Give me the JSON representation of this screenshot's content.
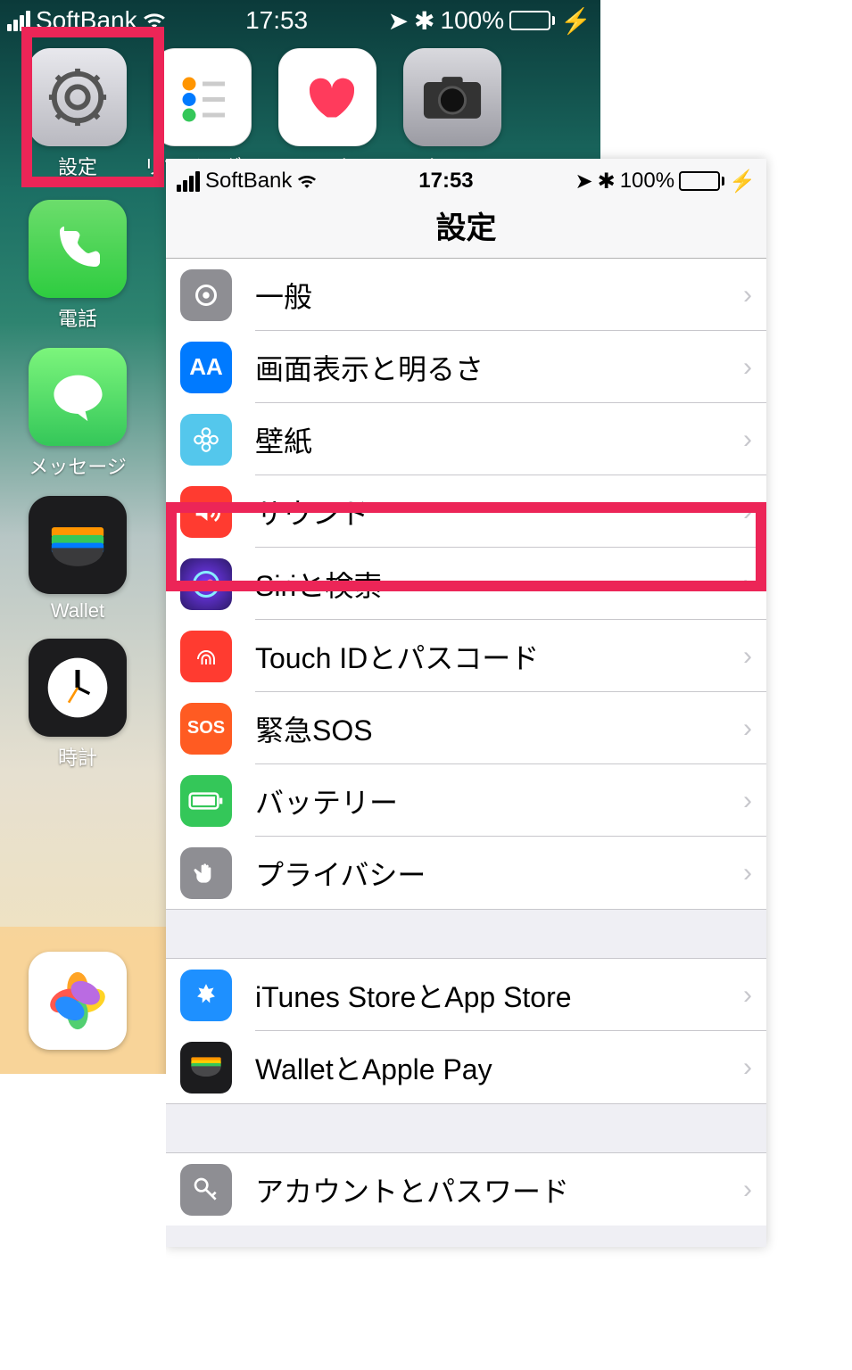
{
  "home": {
    "status": {
      "carrier": "SoftBank",
      "time": "17:53",
      "battery": "100%"
    },
    "apps_row1": [
      {
        "name": "settings",
        "label": "設定"
      },
      {
        "name": "reminders",
        "label": "リマインダー"
      },
      {
        "name": "health",
        "label": "ヘルスケア"
      },
      {
        "name": "camera",
        "label": "カメラ"
      }
    ],
    "apps_col": [
      {
        "name": "phone",
        "label": "電話"
      },
      {
        "name": "messages",
        "label": "メッセージ"
      },
      {
        "name": "wallet",
        "label": "Wallet"
      },
      {
        "name": "clock",
        "label": "時計"
      }
    ],
    "dock_app": {
      "name": "photos",
      "label": ""
    }
  },
  "settings": {
    "status": {
      "carrier": "SoftBank",
      "time": "17:53",
      "battery": "100%"
    },
    "title": "設定",
    "rows1": [
      {
        "name": "general",
        "label": "一般"
      },
      {
        "name": "display",
        "label": "画面表示と明るさ"
      },
      {
        "name": "wallpaper",
        "label": "壁紙"
      },
      {
        "name": "sounds",
        "label": "サウンド",
        "highlighted": true
      },
      {
        "name": "siri",
        "label": "Siriと検索"
      },
      {
        "name": "touchid",
        "label": "Touch IDとパスコード"
      },
      {
        "name": "sos",
        "label": "緊急SOS"
      },
      {
        "name": "battery",
        "label": "バッテリー"
      },
      {
        "name": "privacy",
        "label": "プライバシー"
      }
    ],
    "rows2": [
      {
        "name": "itunes",
        "label": "iTunes StoreとApp Store"
      },
      {
        "name": "walletpay",
        "label": "WalletとApple Pay"
      }
    ],
    "rows3": [
      {
        "name": "accounts",
        "label": "アカウントとパスワード"
      }
    ]
  },
  "highlights": {
    "settings_app": true,
    "sounds_row": true
  }
}
